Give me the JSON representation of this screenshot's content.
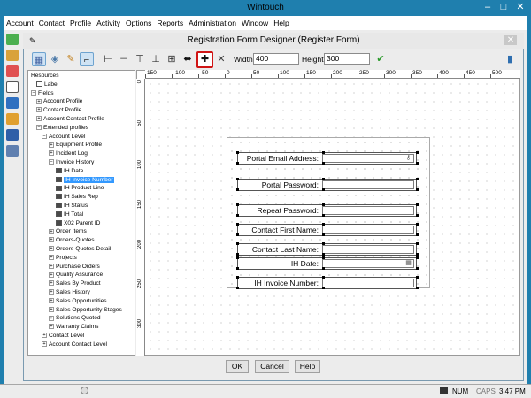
{
  "window": {
    "title": "Wintouch",
    "min": "–",
    "max": "□",
    "close": "✕"
  },
  "menu": [
    "Account",
    "Contact",
    "Profile",
    "Activity",
    "Options",
    "Reports",
    "Administration",
    "Window",
    "Help"
  ],
  "dialog": {
    "title": "Registration Form Designer (Register Form)",
    "close": "✕"
  },
  "toolbar": {
    "width_label": "Width:",
    "width_value": "400",
    "height_label": "Height:",
    "height_value": "300"
  },
  "tree": [
    {
      "label": "Resources",
      "ex": "",
      "icon": ""
    },
    {
      "label": "Label",
      "ex": "",
      "icon": "A"
    },
    {
      "label": "Fields",
      "ex": "−",
      "icon": ""
    },
    {
      "label": "Account Profile",
      "ex": "+",
      "icon": ""
    },
    {
      "label": "Contact Profile",
      "ex": "+",
      "icon": ""
    },
    {
      "label": "Account Contact Profile",
      "ex": "+",
      "icon": ""
    },
    {
      "label": "Extended profiles",
      "ex": "−",
      "icon": ""
    },
    {
      "label": "Account Level",
      "ex": "−",
      "icon": ""
    },
    {
      "label": "Equipment Profile",
      "ex": "+",
      "icon": ""
    },
    {
      "label": "Incident Log",
      "ex": "+",
      "icon": ""
    },
    {
      "label": "Invoice History",
      "ex": "−",
      "icon": ""
    },
    {
      "label": "IH Date",
      "ex": "",
      "icon": "f"
    },
    {
      "label": "IH Invoice Number",
      "ex": "",
      "icon": "f"
    },
    {
      "label": "IH Product Line",
      "ex": "",
      "icon": "f"
    },
    {
      "label": "IH Sales Rep",
      "ex": "",
      "icon": "f"
    },
    {
      "label": "IH Status",
      "ex": "",
      "icon": "f"
    },
    {
      "label": "IH Total",
      "ex": "",
      "icon": "f"
    },
    {
      "label": "X02 Parent ID",
      "ex": "",
      "icon": "f"
    },
    {
      "label": "Order Items",
      "ex": "+",
      "icon": ""
    },
    {
      "label": "Orders-Quotes",
      "ex": "+",
      "icon": ""
    },
    {
      "label": "Orders-Quotes Detail",
      "ex": "+",
      "icon": ""
    },
    {
      "label": "Projects",
      "ex": "+",
      "icon": ""
    },
    {
      "label": "Purchase Orders",
      "ex": "+",
      "icon": ""
    },
    {
      "label": "Quality Assurance",
      "ex": "+",
      "icon": ""
    },
    {
      "label": "Sales By Product",
      "ex": "+",
      "icon": ""
    },
    {
      "label": "Sales History",
      "ex": "+",
      "icon": ""
    },
    {
      "label": "Sales Opportunities",
      "ex": "+",
      "icon": ""
    },
    {
      "label": "Sales Opportunity Stages",
      "ex": "+",
      "icon": ""
    },
    {
      "label": "Solutions Quoted",
      "ex": "+",
      "icon": ""
    },
    {
      "label": "Warranty Claims",
      "ex": "+",
      "icon": ""
    },
    {
      "label": "Contact Level",
      "ex": "+",
      "icon": ""
    },
    {
      "label": "Account Contact Level",
      "ex": "+",
      "icon": ""
    }
  ],
  "selected_tree_item": "IH Invoice Number",
  "ruler_h": [
    "150",
    "-100",
    "-50",
    "0",
    "50",
    "100",
    "150",
    "200",
    "250",
    "300",
    "350",
    "400",
    "450",
    "500"
  ],
  "ruler_v": [
    "0",
    "50",
    "100",
    "150",
    "200",
    "250",
    "300"
  ],
  "form_fields": [
    {
      "label": "Portal Email Address:",
      "icon": "key"
    },
    {
      "label": "Portal Password:",
      "icon": ""
    },
    {
      "label": "Repeat Password:",
      "icon": ""
    },
    {
      "label": "Contact First Name:",
      "icon": ""
    },
    {
      "label": "Contact Last Name:",
      "icon": ""
    },
    {
      "label": "IH Date:",
      "icon": "calendar"
    },
    {
      "label": "IH Invoice Number:",
      "icon": ""
    }
  ],
  "buttons": {
    "ok": "OK",
    "cancel": "Cancel",
    "help": "Help"
  },
  "status": {
    "num": "NUM",
    "caps": "CAPS",
    "time": "3:47 PM"
  },
  "colors": {
    "accent": "#1f7fae",
    "highlight": "#d01515",
    "selection": "#3399ff"
  }
}
